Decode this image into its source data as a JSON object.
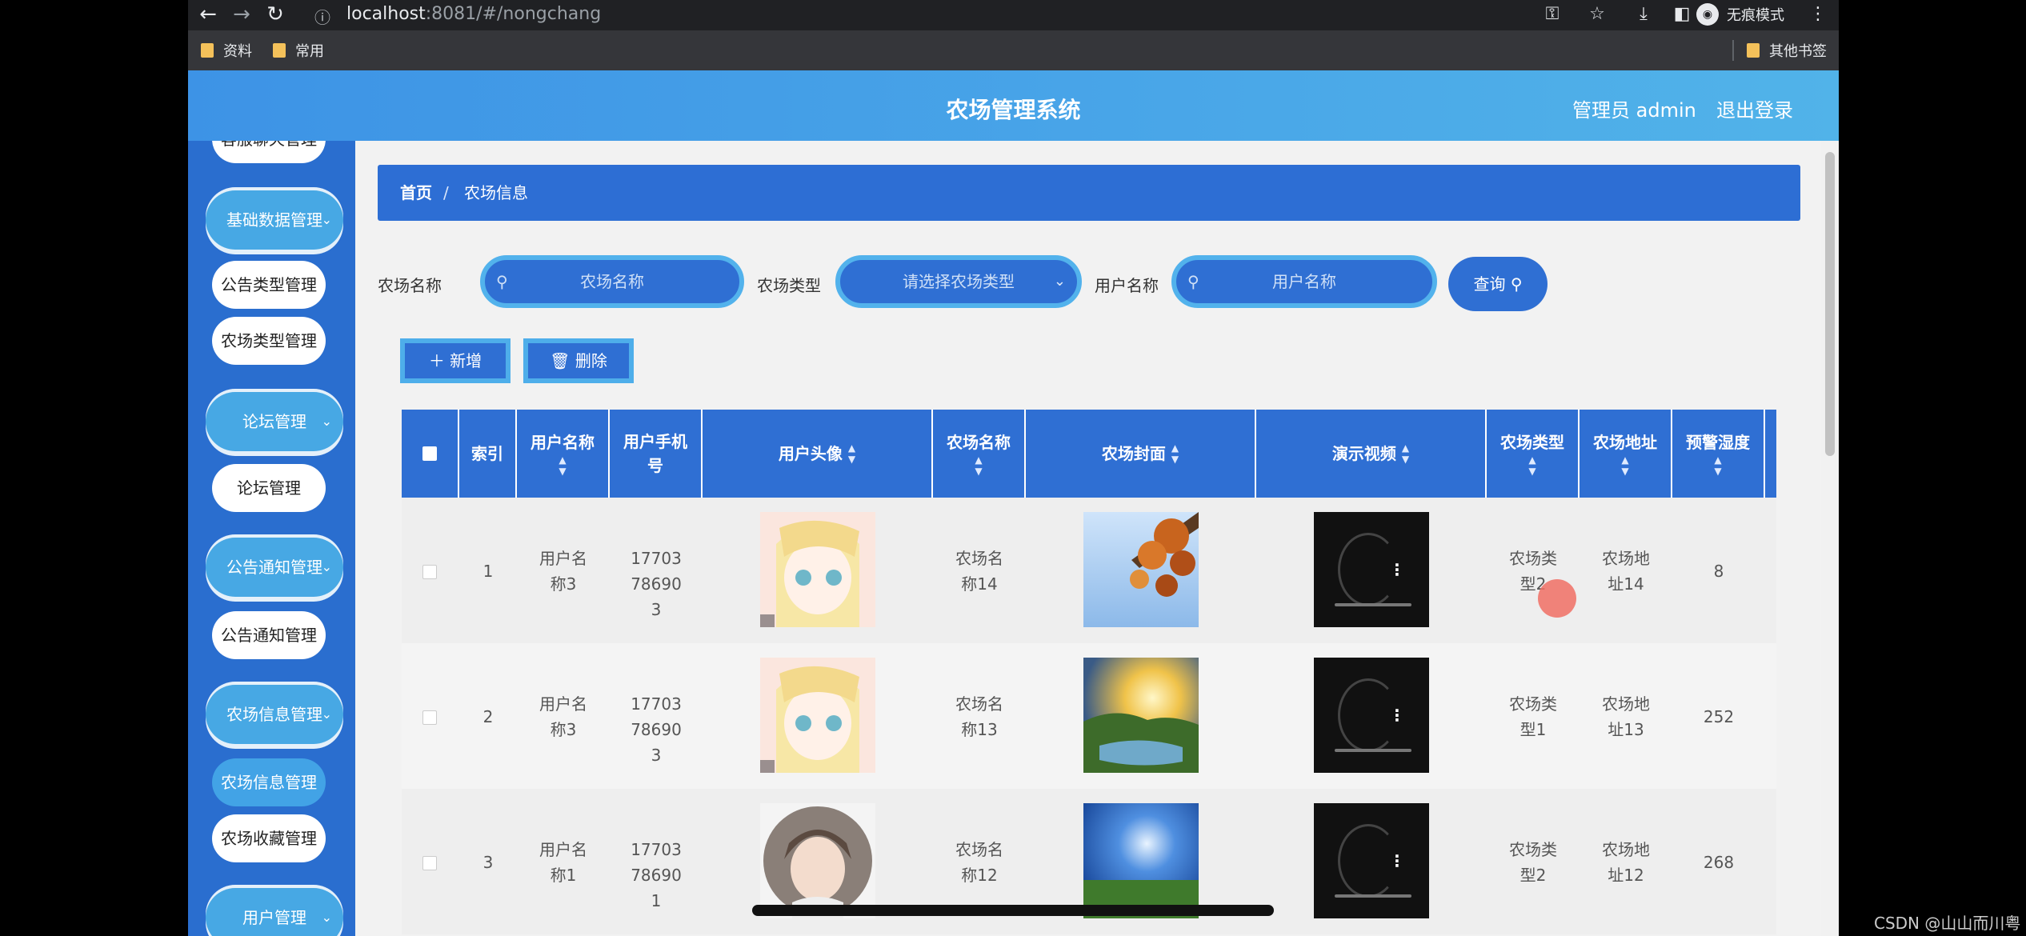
{
  "browser": {
    "url_host": "localhost",
    "url_rest": ":8081/#/nongchang",
    "incognito_label": "无痕模式",
    "bookmarks": [
      "资料",
      "常用"
    ],
    "other_bookmarks": "其他书签"
  },
  "header": {
    "title": "农场管理系统",
    "admin": "管理员 admin",
    "logout": "退出登录"
  },
  "sidebar": {
    "partial_top": "客服聊天管理",
    "groups": [
      {
        "label": "基础数据管理",
        "children": [
          "公告类型管理",
          "农场类型管理"
        ]
      },
      {
        "label": "论坛管理",
        "children": [
          "论坛管理"
        ]
      },
      {
        "label": "公告通知管理",
        "children": [
          "公告通知管理"
        ]
      },
      {
        "label": "农场信息管理",
        "children": [
          "农场信息管理",
          "农场收藏管理"
        ]
      },
      {
        "label": "用户管理",
        "children": []
      }
    ]
  },
  "breadcrumb": {
    "home": "首页",
    "separator": "/",
    "current": "农场信息"
  },
  "filters": {
    "farm_name_label": "农场名称",
    "farm_name_placeholder": "农场名称",
    "farm_type_label": "农场类型",
    "farm_type_placeholder": "请选择农场类型",
    "user_name_label": "用户名称",
    "user_name_placeholder": "用户名称",
    "query_label": "查询"
  },
  "actions": {
    "add_label": "新增",
    "delete_label": "删除"
  },
  "table": {
    "columns": {
      "index": "索引",
      "user_name": "用户名称",
      "user_phone": "用户手机号",
      "avatar": "用户头像",
      "farm_name": "农场名称",
      "cover": "农场封面",
      "video": "演示视频",
      "farm_type": "农场类型",
      "address": "农场地址",
      "warn_humidity": "预警湿度"
    },
    "rows": [
      {
        "index": "1",
        "user_name": "用户名称3",
        "phone": "17703786903",
        "farm_name": "农场名称14",
        "farm_type": "农场类型2",
        "address": "农场地址14",
        "humidity": "8"
      },
      {
        "index": "2",
        "user_name": "用户名称3",
        "phone": "17703786903",
        "farm_name": "农场名称13",
        "farm_type": "农场类型1",
        "address": "农场地址13",
        "humidity": "252"
      },
      {
        "index": "3",
        "user_name": "用户名称1",
        "phone": "17703786901",
        "farm_name": "农场名称12",
        "farm_type": "农场类型2",
        "address": "农场地址12",
        "humidity": "268"
      }
    ]
  },
  "watermark": "CSDN @山山而川粤"
}
